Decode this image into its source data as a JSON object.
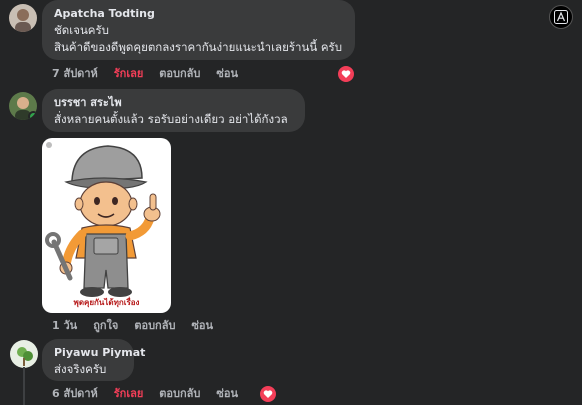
{
  "comments": [
    {
      "author": "Apatcha Todting",
      "lines": [
        "ชัดเจนครับ",
        "สินค้าดีของดีพูดคุยตกลงราคากันง่ายแนะนำเลยร้านนี้ ครับ"
      ],
      "time": "7 สัปดาห์",
      "react_label": "รักเลย",
      "reply_label": "ตอบกลับ",
      "hide_label": "ซ่อน",
      "reaction": "love"
    },
    {
      "author": "บรรชา สระไพ",
      "lines": [
        "สั่งหลายคนตั้งแล้ว รอรับอย่างเดียว อย่าได้กังวล"
      ],
      "time": "1 วัน",
      "react_label": "ถูกใจ",
      "reply_label": "ตอบกลับ",
      "hide_label": "ซ่อน",
      "sticker_caption": "พุดคุยกันได้ทุกเรื่อง"
    },
    {
      "author": "Piyawu Piymat",
      "lines": [
        "ส่งจริงครับ"
      ],
      "time": "6 สัปดาห์",
      "react_label": "รักเลย",
      "reply_label": "ตอบกลับ",
      "hide_label": "ซ่อน",
      "reaction": "love"
    }
  ],
  "colors": {
    "background": "#242526",
    "bubble": "#3a3b3c",
    "love": "#f33e58",
    "muted": "#b0b3b8"
  },
  "icons": [
    "translate-icon",
    "heart-icon",
    "mechanic-boy-sticker"
  ]
}
